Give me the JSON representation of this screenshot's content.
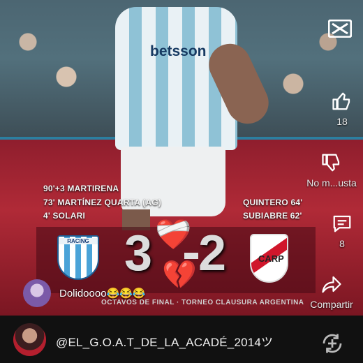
{
  "app": {
    "logo_icon": "capcut-logo-icon"
  },
  "video": {
    "jersey_brand": "betsson",
    "home_scorers": [
      "90'+3 MARTIRENA",
      "73' MARTÍNEZ QUARTA (AG)",
      "4' SOLARI"
    ],
    "away_scorers": [
      "QUINTERO 64'",
      "SUBIABRE 62'"
    ],
    "home_crest_text": "RACING",
    "away_crest_text": "CARP",
    "home_score": "3",
    "away_score": "2",
    "tournament": "OCTAVOS DE FINAL · TORNEO CLAUSURA ARGENTINA"
  },
  "comment": {
    "text": "Dolidoooo😂😂😂"
  },
  "rail": {
    "like_count": "18",
    "dislike_label": "No m...usta",
    "comment_count": "8",
    "share_label": "Compartir"
  },
  "footer": {
    "username": "@EL_G.O.A.T_DE_LA_ACADÉ_2014ツ"
  },
  "colors": {
    "accent_red": "#b02a37",
    "racing_blue": "#4aa3d8"
  }
}
